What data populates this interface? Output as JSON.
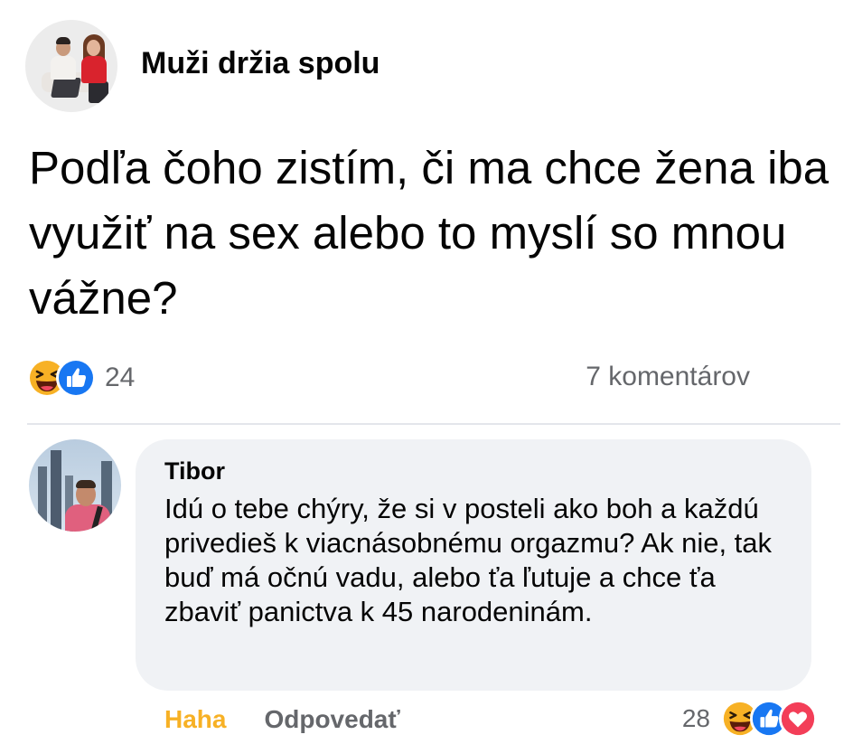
{
  "post": {
    "page_name": "Muži držia spolu",
    "text": "Podľa čoho zistím, či ma chce žena iba využiť na sex alebo to myslí so mnou vážne?",
    "reaction_count": "24",
    "reactions": [
      "haha-icon",
      "like-icon"
    ],
    "comments_label": "7 komentárov"
  },
  "comment": {
    "author": "Tibor",
    "text": "Idú o tebe chýry, že si v posteli ako boh a každú privedieš k viacnásobnému orgazmu? Ak nie, tak buď má očnú vadu, alebo ťa ľutuje a chce ťa zbaviť panictva k 45 narodeninám.",
    "action_reacted": "Haha",
    "action_reply": "Odpovedať",
    "reaction_count": "28",
    "reactions": [
      "haha-icon",
      "like-icon",
      "love-icon"
    ]
  },
  "colors": {
    "haha_yellow": "#f7b125",
    "like_blue": "#1877f2",
    "love_red": "#f33e58",
    "secondary_text": "#65676b",
    "bubble_bg": "#f0f2f5"
  }
}
